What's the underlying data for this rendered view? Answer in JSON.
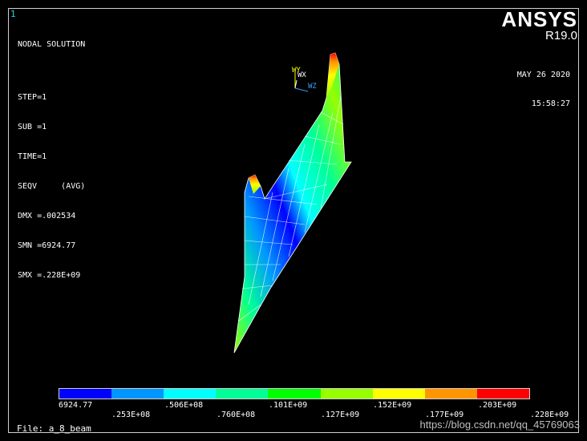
{
  "window_number": "1",
  "brand": {
    "logo": "ANSYS",
    "version": "R19.0"
  },
  "info": {
    "title": "NODAL SOLUTION",
    "step": "STEP=1",
    "sub": "SUB =1",
    "time": "TIME=1",
    "seqv": "SEQV     (AVG)",
    "dmx": "DMX =.002534",
    "smn": "SMN =6924.77",
    "smx": "SMX =.228E+09"
  },
  "datetime": {
    "date": "MAY 26 2020",
    "time": "15:58:27"
  },
  "triad": {
    "wy": "WY",
    "wx": "WX",
    "wz": "WZ"
  },
  "legend": {
    "colors": [
      "#0000ff",
      "#0096ff",
      "#00ffff",
      "#00ff96",
      "#00ff00",
      "#96ff00",
      "#ffff00",
      "#ff9600",
      "#ff0000"
    ],
    "top_labels": [
      "6924.77",
      ".506E+08",
      ".101E+09",
      ".152E+09",
      ".203E+09"
    ],
    "bottom_labels": [
      ".253E+08",
      ".760E+08",
      ".127E+09",
      ".177E+09",
      ".228E+09"
    ]
  },
  "file_label": "File: a_8_beam",
  "watermark": "https://blog.csdn.net/qq_45769063"
}
